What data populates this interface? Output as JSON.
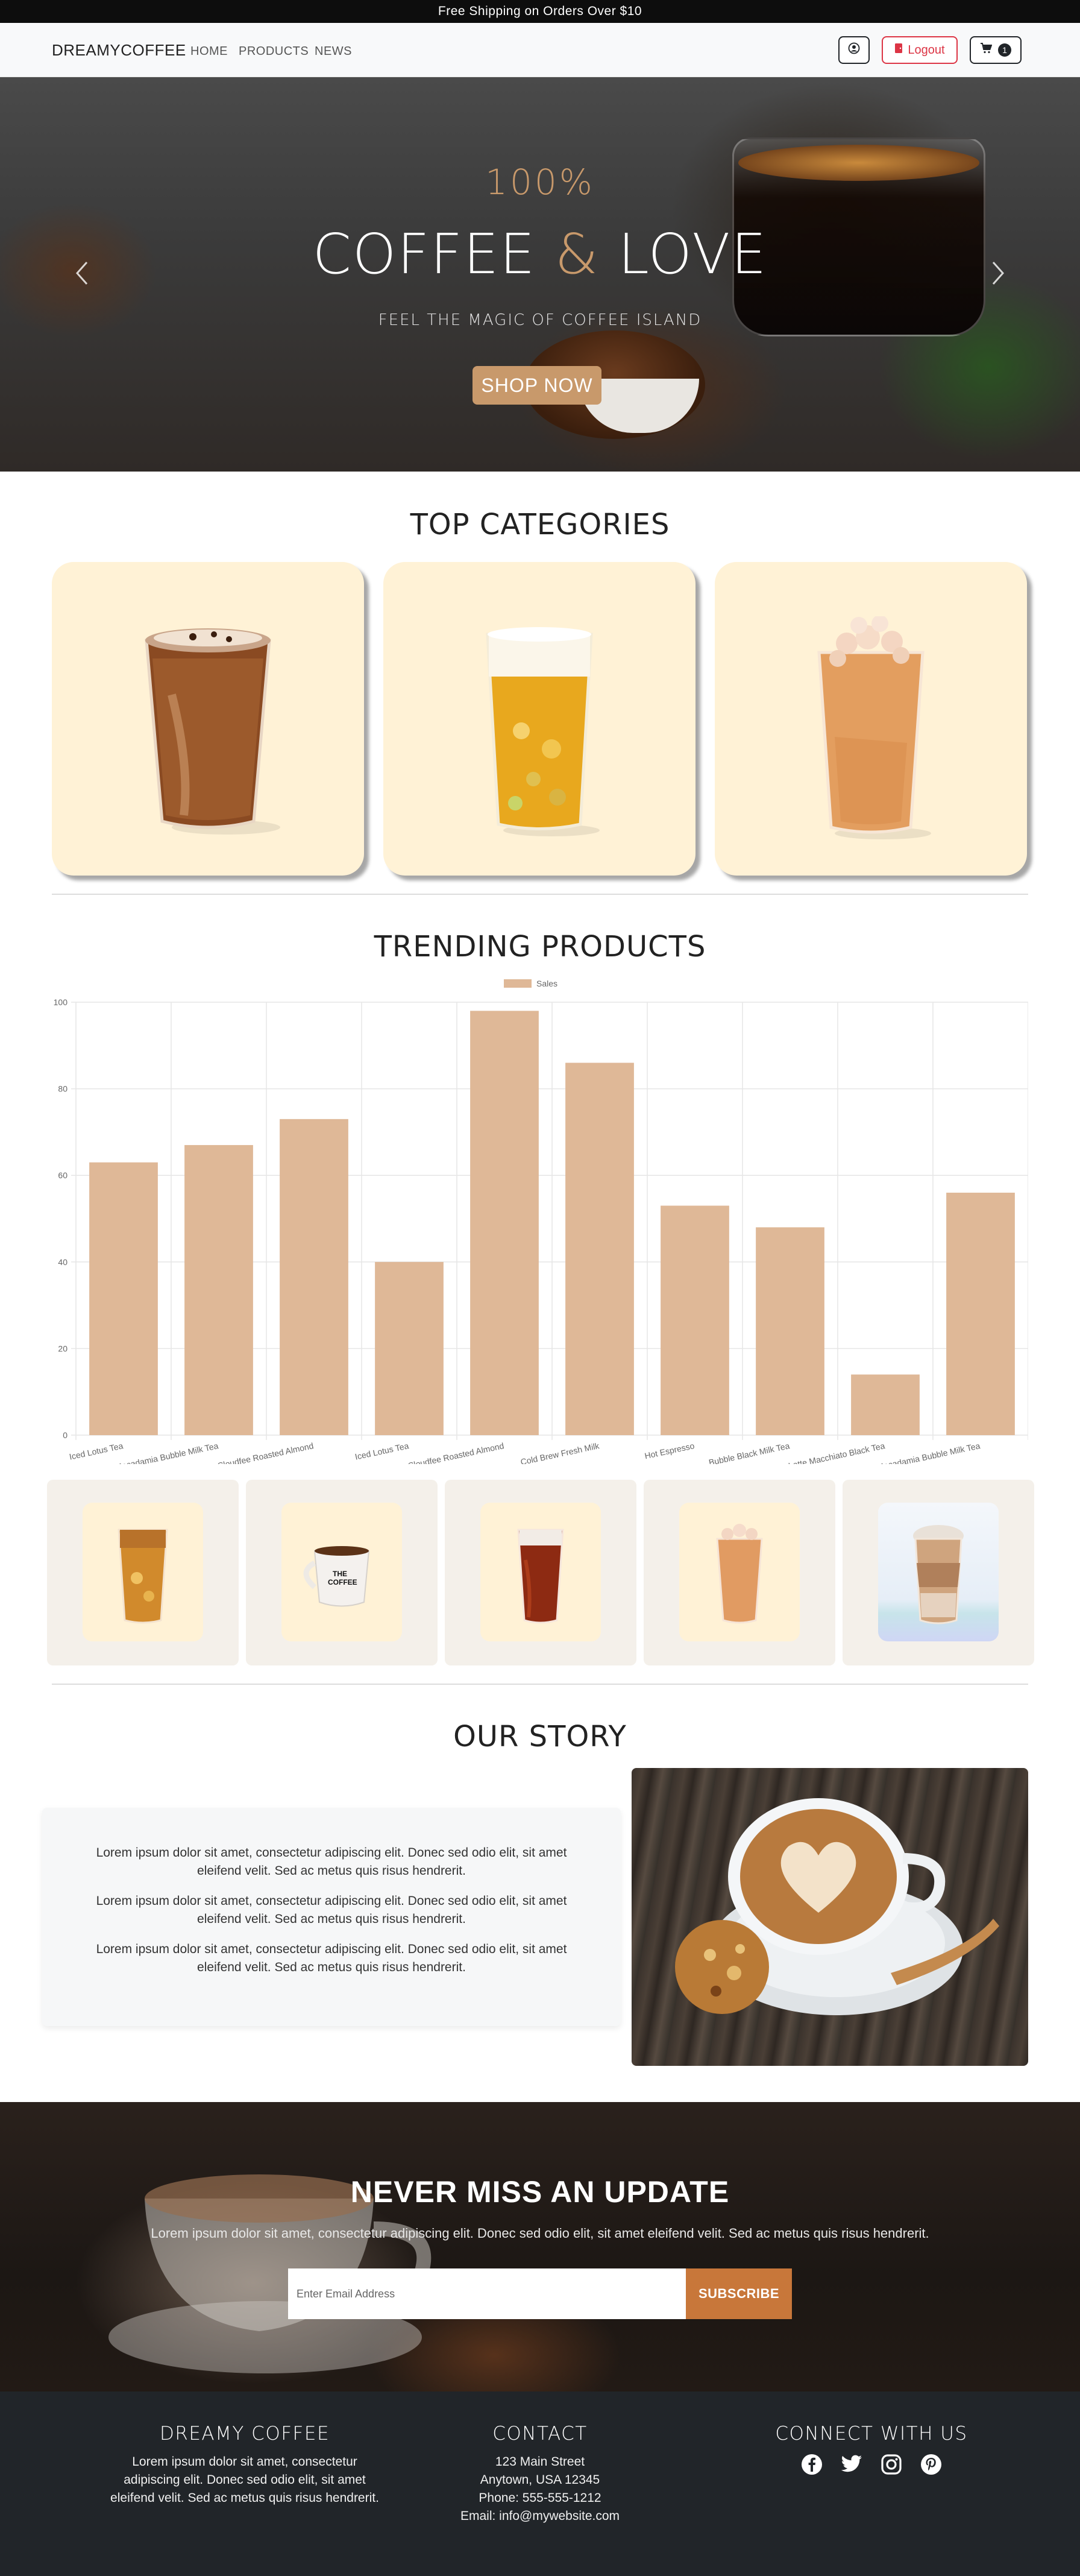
{
  "announcement": "Free Shipping on Orders Over $10",
  "nav": {
    "brand": "DREAMYCOFFEE",
    "links": [
      "HOME",
      "PRODUCTS",
      "NEWS"
    ],
    "logout_label": "Logout",
    "cart_count": "1",
    "icons": {
      "user": "user-circle-icon",
      "logout": "logout-icon",
      "cart": "cart-icon"
    }
  },
  "hero": {
    "eyebrow": "100%",
    "title_left": "COFFEE",
    "title_amp": "&",
    "title_right": "LOVE",
    "subtitle": "FEEL THE MAGIC OF COFFEE ISLAND",
    "cta": "SHOP NOW",
    "prev_icon": "chevron-left-icon",
    "next_icon": "chevron-right-icon"
  },
  "categories": {
    "title": "TOP CATEGORIES",
    "items": [
      {
        "icon": "iced-coffee-image"
      },
      {
        "icon": "iced-tea-image"
      },
      {
        "icon": "milk-tea-image"
      }
    ]
  },
  "trending": {
    "title": "TRENDING PRODUCTS",
    "products": [
      {
        "icon": "iced-lotus-tea-image"
      },
      {
        "icon": "coffee-mug-image"
      },
      {
        "icon": "cold-brew-image"
      },
      {
        "icon": "bubble-milk-tea-image"
      },
      {
        "icon": "macadamia-milk-tea-image"
      }
    ]
  },
  "chart_data": {
    "type": "bar",
    "legend": [
      "Sales"
    ],
    "legend_position": "top-center",
    "categories": [
      "Iced Lotus Tea",
      "Macadamia Bubble Milk Tea",
      "Cloudfee Roasted Almond",
      "Iced Lotus Tea",
      "Cloudfee Roasted Almond",
      "Cold Brew Fresh Milk",
      "Hot Espresso",
      "Bubble Black Milk Tea",
      "Latte Macchiato Black Tea",
      "Macadamia Bubble Milk Tea"
    ],
    "series": [
      {
        "name": "Sales",
        "values": [
          63,
          67,
          73,
          40,
          98,
          86,
          53,
          48,
          14,
          56
        ]
      }
    ],
    "yticks": [
      "0",
      "20",
      "40",
      "60",
      "80",
      "100"
    ],
    "ylim": [
      0,
      100
    ],
    "grid": true,
    "bar_color": "#dfb897"
  },
  "story": {
    "title": "OUR STORY",
    "paragraphs": [
      "Lorem ipsum dolor sit amet, consectetur adipiscing elit. Donec sed odio elit, sit amet eleifend velit. Sed ac metus quis risus hendrerit.",
      "Lorem ipsum dolor sit amet, consectetur adipiscing elit. Donec sed odio elit, sit amet eleifend velit. Sed ac metus quis risus hendrerit.",
      "Lorem ipsum dolor sit amet, consectetur adipiscing elit. Donec sed odio elit, sit amet eleifend velit. Sed ac metus quis risus hendrerit."
    ]
  },
  "newsletter": {
    "title": "NEVER MISS AN UPDATE",
    "text": "Lorem ipsum dolor sit amet, consectetur adipiscing elit. Donec sed odio elit, sit amet eleifend velit. Sed ac metus quis risus hendrerit.",
    "placeholder": "Enter Email Address",
    "button": "SUBSCRIBE"
  },
  "footer": {
    "about_title": "DREAMY COFFEE",
    "about_text": "Lorem ipsum dolor sit amet, consectetur adipiscing elit. Donec sed odio elit, sit amet eleifend velit. Sed ac metus quis risus hendrerit.",
    "contact_title": "CONTACT",
    "address1": "123 Main Street",
    "address2": "Anytown, USA 12345",
    "phone": "Phone: 555-555-1212",
    "email": "Email: info@mywebsite.com",
    "social_title": "CONNECT WITH US",
    "social_icons": [
      "facebook-icon",
      "twitter-icon",
      "instagram-icon",
      "pinterest-icon"
    ]
  }
}
